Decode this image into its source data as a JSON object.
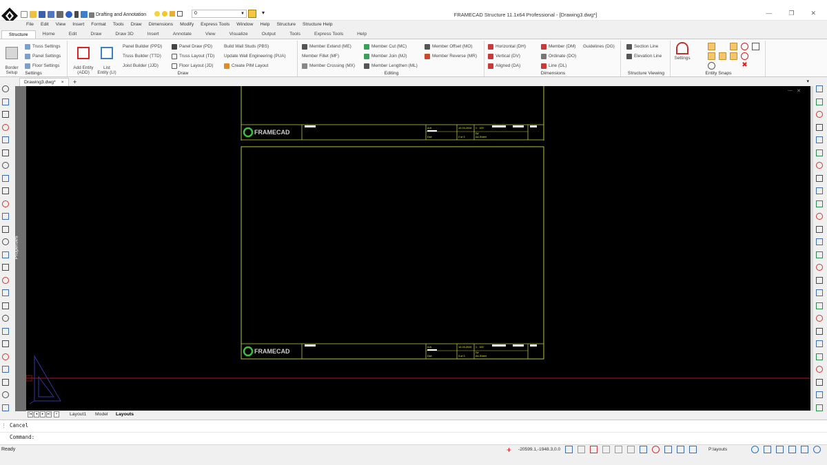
{
  "title_bar": {
    "workspace": "Drafting and Annotation",
    "layer": "0",
    "window_title": "FRAMECAD Structure 11.1x64 Professional  - [Drawing3.dwg*]",
    "minimize_glyph": "—",
    "maximize_glyph": "❐",
    "close_glyph": "✕"
  },
  "menu": [
    "File",
    "Edit",
    "View",
    "Insert",
    "Format",
    "Tools",
    "Draw",
    "Dimensions",
    "Modify",
    "Express Tools",
    "Window",
    "Help",
    "Structure",
    "Structure Help"
  ],
  "ribbon_tabs": [
    "Structure",
    "Home",
    "Edit",
    "Draw",
    "Draw 3D",
    "Insert",
    "Annotate",
    "View",
    "Visualize",
    "Output",
    "Tools",
    "Express Tools",
    "Help"
  ],
  "ribbon": {
    "settings": {
      "label": "Settings",
      "border_setup": "Border\nSetup",
      "truss_settings": "Truss Settings",
      "panel_settings": "Panel Settings",
      "floor_settings": "Floor Settings"
    },
    "draw": {
      "label": "Draw",
      "add_entity": "Add Entity\n(ADD)",
      "list_entity": "List\nEntity (LI)",
      "panel_builder": "Panel Builder (PPD)",
      "truss_builder": "Truss Builder (TTD)",
      "joist_builder": "Joist Builder (JJD)",
      "panel_draw": "Panel Draw (PD)",
      "truss_layout": "Truss Layout (TD)",
      "floor_layout": "Floor Layout (JD)",
      "build_wall_studs": "Build Wall Studs (PBS)",
      "update_wall_engineering": "Update Wall Engineering (PUA)",
      "create_pim_layout": "Create PIM Layout"
    },
    "editing": {
      "label": "Editing",
      "member_extend": "Member Extend (ME)",
      "member_fillet": "Member Fillet (MF)",
      "member_crossing": "Member Crossing (MX)",
      "member_cut": "Member Cut (MC)",
      "member_join": "Member Join (MJ)",
      "member_lengthen": "Member Lengthen (ML)",
      "member_offset": "Member Offset (MO)",
      "member_reverse": "Member Reverse (MR)"
    },
    "dimensions": {
      "label": "Dimensions",
      "horizontal": "Horizontal (DH)",
      "vertical": "Vertical (DV)",
      "aligned": "Aligned (DA)",
      "member": "Member (DM)",
      "ordinate": "Ordinate (DO)",
      "line": "Line (DL)",
      "guidelines": "Guidelines (DG)"
    },
    "structure_viewing": {
      "label": "Structure Viewing",
      "section_line": "Section Line",
      "elevation_line": "Elevation Line"
    },
    "entity_snaps": {
      "label": "Entity Snaps",
      "settings": "Settings"
    }
  },
  "document": {
    "tab": "Drawing3.dwg*",
    "close_glyph": "×",
    "add_glyph": "+",
    "menu_glyph": "▾"
  },
  "properties_label": "Properties",
  "sheet": {
    "logo_text": "FRAMECAD",
    "rev": "A/A",
    "cells_upper": {
      "date": "10-03-2024",
      "scale": "1 : 100",
      "page": "2 of 3",
      "size": "A4-Sheet",
      "code": "S#",
      "dwg": "Dwt"
    },
    "cells_lower": {
      "date": "10-03-2024",
      "scale": "1 : 100",
      "page": "3 of 3",
      "size": "A4-Sheet",
      "code": "S#",
      "dwg": "Dwt"
    }
  },
  "layout_tabs": {
    "nav": [
      "|◂",
      "◂",
      "▸",
      "▸|",
      "+"
    ],
    "tabs": [
      "Layout1",
      "Model",
      "Layouts"
    ],
    "active": "Layouts"
  },
  "command": {
    "history": "Cancel",
    "prompt": "Command:"
  },
  "status": {
    "ready": "Ready",
    "coordinates": "-20599.1,-1948.3,0.0",
    "layout": "P:layouts"
  },
  "colors": {
    "canvas": "#000000",
    "sheet_border": "#b5c83a",
    "title_block_text": "#e6e62a",
    "crosshair": "#b01818",
    "ucs": "#2c3aa0",
    "logo_green": "#3fbf3f"
  }
}
